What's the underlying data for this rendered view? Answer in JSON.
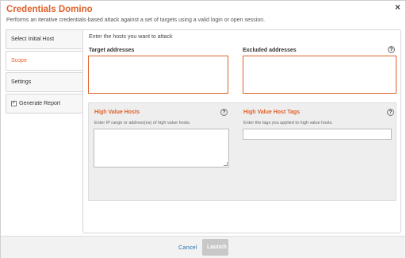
{
  "dialog": {
    "title": "Credentials Domino",
    "subtitle": "Performs an iterative credentials-based attack against a set of targets using a valid login or open session.",
    "close_glyph": "×"
  },
  "sidebar": {
    "items": [
      {
        "label": "Select Initial Host"
      },
      {
        "label": "Scope"
      },
      {
        "label": "Settings"
      },
      {
        "label": "Generate Report",
        "checked": true
      }
    ]
  },
  "scope": {
    "instruction": "Enter the hosts you want to attack",
    "target_label": "Target addresses",
    "excluded_label": "Excluded addresses",
    "help_glyph": "?",
    "high_value_hosts": {
      "label": "High Value Hosts",
      "hint": "Enter IP range or address(es) of high value hosts."
    },
    "high_value_tags": {
      "label": "High Value Host Tags",
      "hint": "Enter the tags you applied to high value hosts."
    }
  },
  "footer": {
    "cancel_label": "Cancel",
    "launch_label": "Launch"
  },
  "colors": {
    "accent": "#e0612a",
    "link": "#2a77b5",
    "disabled_button": "#c8c8c8"
  },
  "icons": {
    "close": "close-icon",
    "help": "help-icon",
    "checkbox": "checkbox-checked-icon"
  }
}
